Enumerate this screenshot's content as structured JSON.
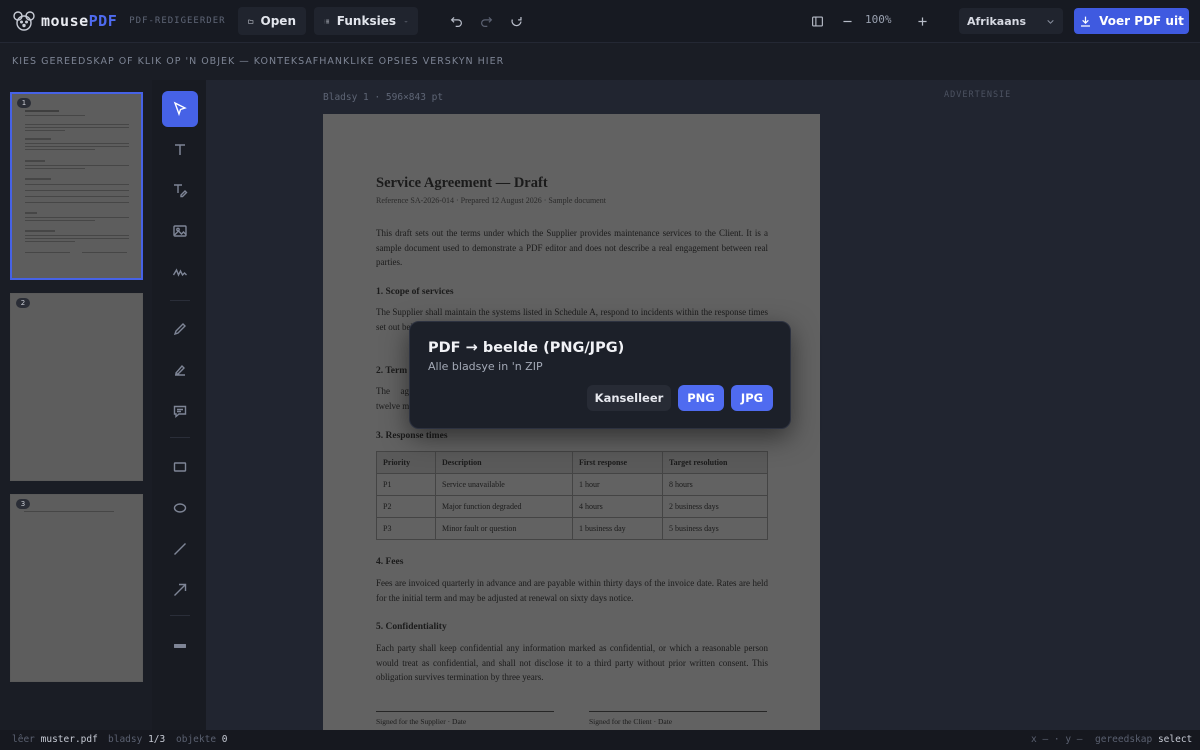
{
  "app": {
    "name_main": "mouse",
    "name_accent": "PDF",
    "subtitle": "PDF-REDIGEERDER"
  },
  "toolbar": {
    "open_label": "Open",
    "functions_label": "Funksies",
    "zoom": "100%",
    "language": "Afrikaans",
    "export_label": "Voer PDF uit"
  },
  "hint": "KIES GEREEDSKAP OF KLIK OP 'N OBJEK — KONTEKSAFHANKLIKE OPSIES VERSKYN HIER",
  "thumbnails": [
    {
      "number": "1",
      "active": true
    },
    {
      "number": "2",
      "active": false
    },
    {
      "number": "3",
      "active": false
    }
  ],
  "tools": [
    "select",
    "text",
    "text-edit",
    "image",
    "signature",
    "pen",
    "highlighter",
    "comment",
    "rectangle",
    "ellipse",
    "line",
    "arrow",
    "redact"
  ],
  "canvas": {
    "page_label": "Bladsy 1 · 596×843 pt",
    "ad_label": "ADVERTENSIE"
  },
  "document": {
    "title": "Service Agreement — Draft",
    "subtitle": "Reference SA-2026-014 · Prepared 12 August 2026 · Sample document",
    "intro": "This draft sets out the terms under which the Supplier provides maintenance services to the Client. It is a sample document used to demonstrate a PDF editor and does not describe a real engagement between real parties.",
    "sections": {
      "s1_heading": "1. Scope of services",
      "s1_text": "The Supplier shall maintain the systems listed in Schedule A, respond to incidents within the response times set out below, and provide a written report summarising the work performed at the end of each quarter. W",
      "s2_heading": "2. Term",
      "s2_text": "The agre twelve m",
      "s3_heading": "3. Response times",
      "s4_heading": "4. Fees",
      "s4_text": "Fees are invoiced quarterly in advance and are payable within thirty days of the invoice date. Rates are held for the initial term and may be adjusted at renewal on sixty days notice.",
      "s5_heading": "5. Confidentiality",
      "s5_text": "Each party shall keep confidential any information marked as confidential, or which a reasonable person would treat as confidential, and shall not disclose it to a third party without prior written consent. This obligation survives termination by three years."
    },
    "table": {
      "headers": [
        "Priority",
        "Description",
        "First response",
        "Target resolution"
      ],
      "rows": [
        [
          "P1",
          "Service unavailable",
          "1 hour",
          "8 hours"
        ],
        [
          "P2",
          "Major function degraded",
          "4 hours",
          "2 business days"
        ],
        [
          "P3",
          "Minor fault or question",
          "1 business day",
          "5 business days"
        ]
      ]
    },
    "sig_supplier": "Signed for the Supplier · Date",
    "sig_client": "Signed for the Client · Date"
  },
  "dialog": {
    "title": "PDF → beelde (PNG/JPG)",
    "subtitle": "Alle bladsye in 'n ZIP",
    "cancel_label": "Kanselleer",
    "png_label": "PNG",
    "jpg_label": "JPG"
  },
  "status": {
    "file_label": "lêer",
    "file_name": "muster.pdf",
    "page_label": "bladsy",
    "page_value": "1/3",
    "objects_label": "objekte",
    "objects_value": "0",
    "coords": "x — · y —",
    "tool_label": "gereedskap",
    "tool_value": "select"
  }
}
